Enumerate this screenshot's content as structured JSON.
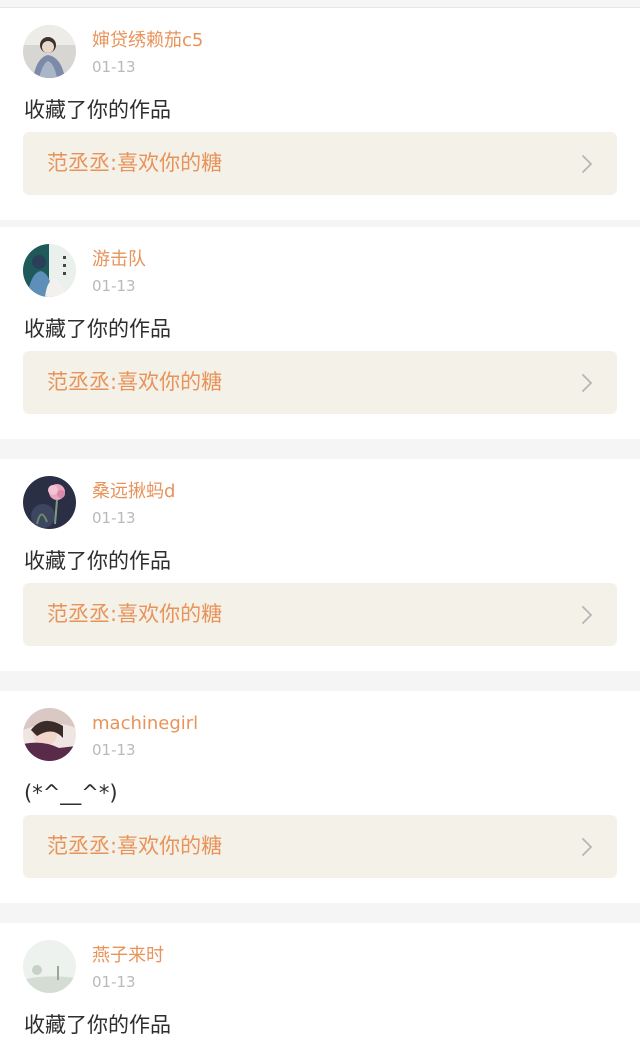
{
  "feed": {
    "items": [
      {
        "username": "婶贷绣赖茄c5",
        "date": "01-13",
        "text": "收藏了你的作品",
        "work": "范丞丞:喜欢你的糖",
        "avatar_icon": "girl-portrait-avatar"
      },
      {
        "username": "游击队",
        "date": "01-13",
        "text": "收藏了你的作品",
        "work": "范丞丞:喜欢你的糖",
        "avatar_icon": "couple-portrait-avatar"
      },
      {
        "username": "桑远揪蚂d",
        "date": "01-13",
        "text": "收藏了你的作品",
        "work": "范丞丞:喜欢你的糖",
        "avatar_icon": "lotus-flower-avatar"
      },
      {
        "username": "machinegirl",
        "date": "01-13",
        "text": "(*^__^*)",
        "work": "范丞丞:喜欢你的糖",
        "avatar_icon": "girl-closeup-avatar"
      },
      {
        "username": "燕子来时",
        "date": "01-13",
        "text": "收藏了你的作品",
        "work": "",
        "avatar_icon": "pale-landscape-avatar"
      }
    ]
  },
  "colors": {
    "username": "#e8935a",
    "work_link_text": "#e8935a",
    "work_link_bg": "#f4f2e8",
    "timestamp": "#b9b9b9",
    "comment": "#2e2e2e",
    "separator": "#f5f5f5"
  }
}
